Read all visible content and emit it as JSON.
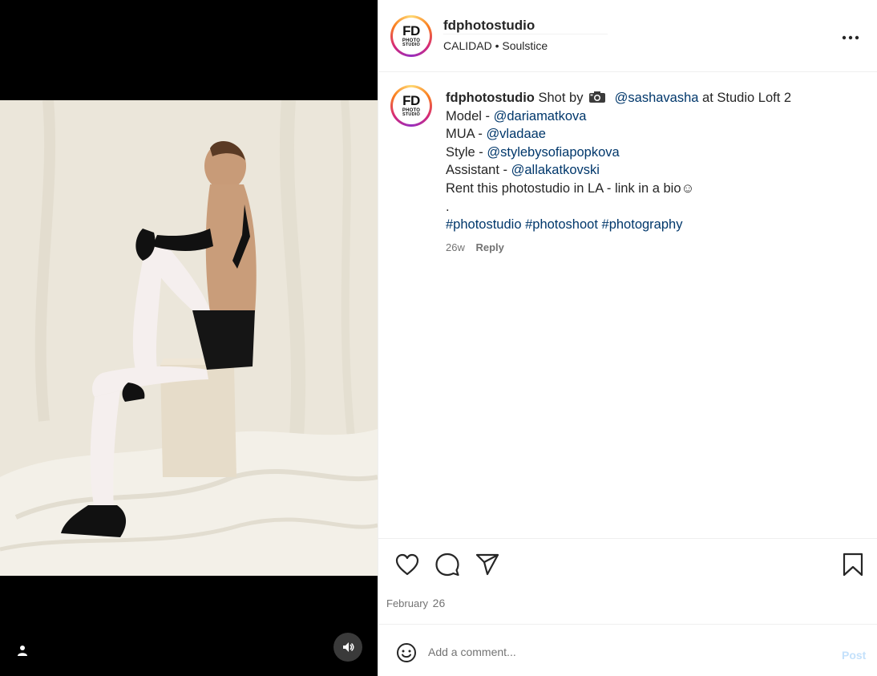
{
  "post": {
    "username": "fdphotostudio",
    "audio_line": "CALIDAD • Soulstice",
    "avatar": {
      "main": "FD",
      "line1": "PHOTO",
      "line2": "STUDIO"
    }
  },
  "caption": {
    "username": "fdphotostudio",
    "shot_by": "Shot by",
    "camera_icon": "camera-icon",
    "photographer": "@sashavasha",
    "at_text": "at Studio Loft 2",
    "model_label": "Model -",
    "model_handle": "@dariamatkova",
    "mua_label": "MUA -",
    "mua_handle": "@vladaae",
    "style_label": "Style -",
    "style_handle": "@stylebysofiapopkova",
    "assistant_label": "Assistant -",
    "assistant_handle": "@allakatkovski",
    "rent_line": "Rent this photostudio in LA - link in a bio☺",
    "dot": ".",
    "hashtags": [
      "#photostudio",
      "#photoshoot",
      "#photography"
    ]
  },
  "meta": {
    "age": "26w",
    "reply": "Reply"
  },
  "actions": {
    "icons": [
      "heart-icon",
      "comment-icon",
      "share-icon",
      "bookmark-icon"
    ],
    "date_month": "February",
    "date_day": "26"
  },
  "comment": {
    "placeholder": "Add a comment...",
    "post_label": "Post",
    "emoji_icon": "emoji-icon"
  },
  "media": {
    "icons": [
      "user-tag-icon",
      "audio-icon"
    ]
  },
  "colors": {
    "link": "#00376b",
    "secondary_text": "#737373",
    "post_disabled": "#c4e1fb",
    "media_bg": "#000000"
  }
}
